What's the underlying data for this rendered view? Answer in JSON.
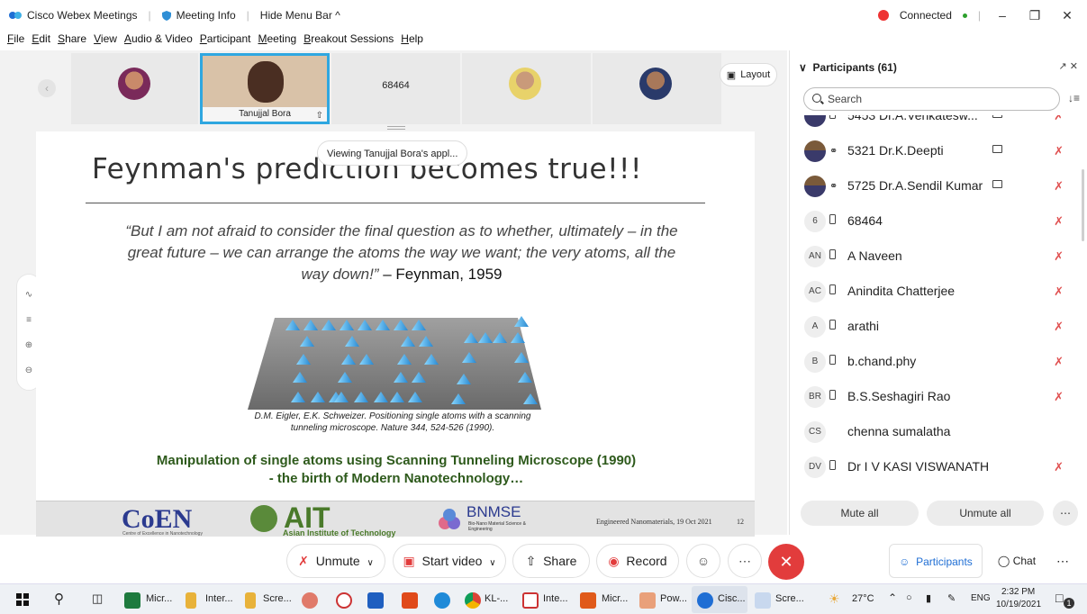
{
  "titlebar": {
    "app_name": "Cisco Webex Meetings",
    "meeting_info": "Meeting Info",
    "hide_menu": "Hide Menu Bar ^",
    "status": "Connected"
  },
  "menu": [
    "File",
    "Edit",
    "Share",
    "View",
    "Audio & Video",
    "Participant",
    "Meeting",
    "Breakout Sessions",
    "Help"
  ],
  "thumbnails": {
    "active_name": "Tanujjal Bora",
    "number_tile": "68464",
    "layout_label": "Layout"
  },
  "viewing_tip": "Viewing Tanujjal Bora's appl...",
  "slide": {
    "title": "Feynman's prediction becomes true!!!",
    "quote": "“But I am not afraid to consider the final question as to whether, ultimately – in the great future – we can arrange the atoms the way we want; the very atoms, all the way down!”",
    "quote_attr": " – Feynman, 1959",
    "caption": "D.M. Eigler, E.K. Schweizer. Positioning single atoms with a scanning tunneling microscope. Nature 344, 524-526 (1990).",
    "green_line1": "Manipulation of single atoms using Scanning Tunneling Microscope (1990)",
    "green_line2": "- the birth of Modern Nanotechnology…",
    "footer": {
      "coen": "CoEN",
      "coen_sub": "Centre of Excellence in Nanotechnology",
      "ait": "AIT",
      "ait_sub": "Asian Institute of Technology",
      "bnmse": "BNMSE",
      "bnmse_sub": "Bio-Nano Material Science & Engineering",
      "note": "Engineered Nanomaterials, 19 Oct 2021",
      "page": "12"
    }
  },
  "panel": {
    "title": "Participants (61)",
    "search_placeholder": "Search",
    "participants": [
      {
        "initials": "",
        "name": "5453 Dr.A.Venkatesw...",
        "photo": true,
        "muted": true
      },
      {
        "initials": "",
        "name": "5321 Dr.K.Deepti",
        "photo": true,
        "muted": true
      },
      {
        "initials": "",
        "name": "5725 Dr.A.Sendil Kumar",
        "photo": true,
        "muted": true
      },
      {
        "initials": "6",
        "name": "68464",
        "photo": false,
        "muted": true
      },
      {
        "initials": "AN",
        "name": "A Naveen",
        "photo": false,
        "muted": true
      },
      {
        "initials": "AC",
        "name": "Anindita Chatterjee",
        "photo": false,
        "muted": true
      },
      {
        "initials": "A",
        "name": "arathi",
        "photo": false,
        "muted": true
      },
      {
        "initials": "B",
        "name": "b.chand.phy",
        "photo": false,
        "muted": true
      },
      {
        "initials": "BR",
        "name": "B.S.Seshagiri Rao",
        "photo": false,
        "muted": true
      },
      {
        "initials": "CS",
        "name": "chenna sumalatha",
        "photo": false,
        "muted": false
      },
      {
        "initials": "DV",
        "name": "Dr I V KASI VISWANATH",
        "photo": false,
        "muted": true
      }
    ],
    "mute_all": "Mute all",
    "unmute_all": "Unmute all"
  },
  "controls": {
    "unmute": "Unmute",
    "start_video": "Start video",
    "share": "Share",
    "record": "Record",
    "participants": "Participants",
    "chat": "Chat"
  },
  "taskbar": {
    "apps": [
      "Micr...",
      "Inter...",
      "Scre...",
      "KL-...",
      "Inte...",
      "Micr...",
      "Pow...",
      "Cisc...",
      "Scre..."
    ],
    "weather": "27°C",
    "lang": "ENG",
    "time": "2:32 PM",
    "date": "10/19/2021",
    "notif": "1"
  },
  "colors": {
    "accent": "#2fa7e0",
    "end": "#e23c3c",
    "green_text": "#2e5a1c"
  }
}
